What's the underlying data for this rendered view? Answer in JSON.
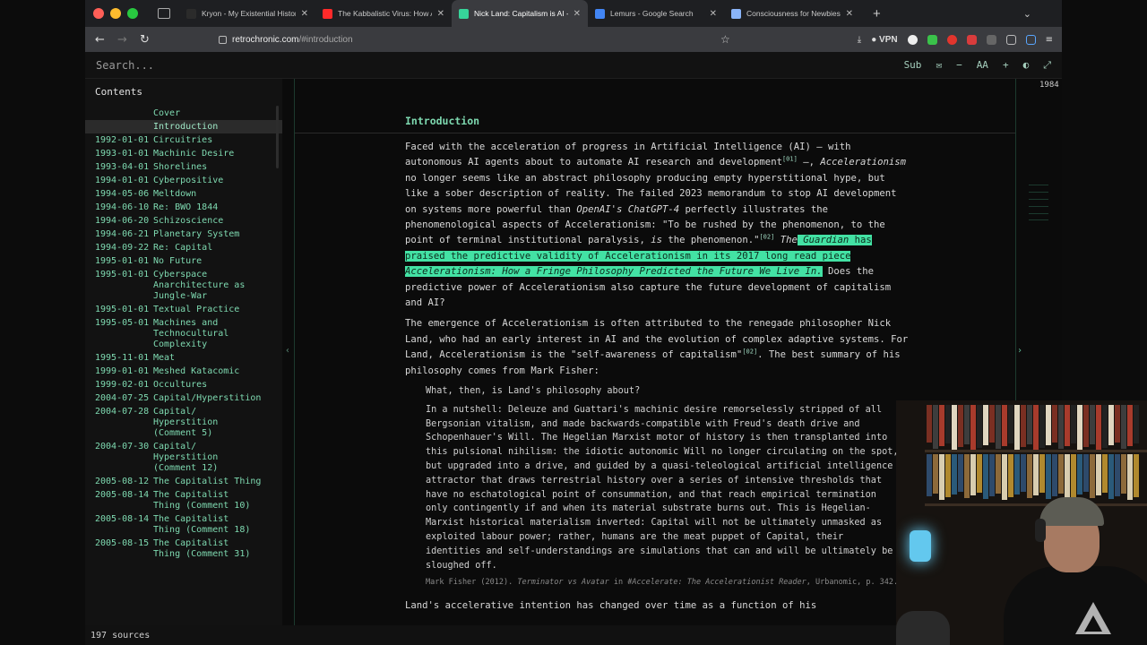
{
  "browser": {
    "tabs": [
      {
        "title": "Kryon - My Existential History -",
        "favicon_color": "#2b2b2b",
        "active": false
      },
      {
        "title": "The Kabbalistic Virus: How Artif",
        "favicon_color": "#ff2a2a",
        "active": false
      },
      {
        "title": "Nick Land: Capitalism is AI - Ac",
        "favicon_color": "#37d49a",
        "active": true
      },
      {
        "title": "Lemurs - Google Search",
        "favicon_color": "#4285f4",
        "active": false
      },
      {
        "title": "Consciousness for Newbies :: D",
        "favicon_color": "#8ab4f8",
        "active": false
      }
    ],
    "new_tab": "+",
    "url_host": "retrochronic.com",
    "url_path": "/#introduction",
    "vpn_label": "VPN"
  },
  "reader": {
    "search_placeholder": "Search...",
    "toolbar": {
      "sub_label": "Sub",
      "font_label": "AA",
      "minus": "−",
      "plus": "+"
    },
    "contents_label": "Contents",
    "page_number": "1984",
    "toc": [
      {
        "date": "",
        "title": "Cover",
        "indent": true,
        "selected": false
      },
      {
        "date": "",
        "title": "Introduction",
        "indent": true,
        "selected": true
      },
      {
        "date": "1992-01-01",
        "title": "Circuitries"
      },
      {
        "date": "1993-01-01",
        "title": "Machinic Desire"
      },
      {
        "date": "1993-04-01",
        "title": "Shorelines"
      },
      {
        "date": "1994-01-01",
        "title": "Cyberpositive"
      },
      {
        "date": "1994-05-06",
        "title": "Meltdown"
      },
      {
        "date": "1994-06-10",
        "title": "Re: BWO 1844"
      },
      {
        "date": "1994-06-20",
        "title": "Schizoscience"
      },
      {
        "date": "1994-06-21",
        "title": "Planetary System"
      },
      {
        "date": "1994-09-22",
        "title": "Re: Capital"
      },
      {
        "date": "1995-01-01",
        "title": "No Future"
      },
      {
        "date": "1995-01-01",
        "title": "Cyberspace\nAnarchitecture as\nJungle-War"
      },
      {
        "date": "1995-01-01",
        "title": "Textual Practice"
      },
      {
        "date": "1995-05-01",
        "title": "Machines and\nTechnocultural\nComplexity"
      },
      {
        "date": "1995-11-01",
        "title": "Meat"
      },
      {
        "date": "1999-01-01",
        "title": "Meshed Katacomic"
      },
      {
        "date": "1999-02-01",
        "title": "Occultures"
      },
      {
        "date": "2004-07-25",
        "title": "Capital/Hyperstition"
      },
      {
        "date": "2004-07-28",
        "title": "Capital/\nHyperstition\n(Comment 5)"
      },
      {
        "date": "2004-07-30",
        "title": "Capital/\nHyperstition\n(Comment 12)"
      },
      {
        "date": "2005-08-12",
        "title": "The Capitalist Thing"
      },
      {
        "date": "2005-08-14",
        "title": "The Capitalist\nThing (Comment 10)"
      },
      {
        "date": "2005-08-14",
        "title": "The Capitalist\nThing (Comment 18)"
      },
      {
        "date": "2005-08-15",
        "title": "The Capitalist\nThing (Comment 31)"
      }
    ],
    "sources_count": "197 sources"
  },
  "article": {
    "heading": "Introduction",
    "p1": {
      "a": "Faced with the acceleration of progress in Artificial Intelligence (AI) — with autonomous AI agents about to automate AI research and development",
      "ref1": "[01]",
      "b": " —, ",
      "accel": "Accelerationism",
      "c": " no longer seems like an abstract philosophy producing empty hyperstitional hype, but like a sober description of reality. The failed 2023 memorandum to stop AI development on systems more powerful than ",
      "openai": "OpenAI's ChatGPT-4",
      "d": " perfectly illustrates the phenomenological aspects of Accelerationism: \"To be rushed by the phenomenon, to the point of terminal institutional paralysis, ",
      "is": "is",
      "e": " the phenomenon.\"",
      "ref2": "[02]",
      "f": " ",
      "hl_the": "The",
      "hl_guardian": " Guardian",
      "hl_mid": " has praised the predictive validity of Accelerationism in its 2017 long read piece ",
      "hl_title": "Accelerationism: How a Fringe Philosophy Predicted the Future We Live In.",
      "g": " Does the predictive power of Accelerationism also capture the future development of capitalism and AI?"
    },
    "p2": {
      "a": "The emergence of Accelerationism is often attributed to the renegade philosopher Nick Land, who had an early interest in AI and the evolution of complex adaptive systems. For Land, Accelerationism is the \"self-awareness of capitalism\"",
      "ref": "[02]",
      "b": ". The best summary of his philosophy comes from Mark Fisher:"
    },
    "quote_q": "What, then, is Land's philosophy about?",
    "quote_body": "In a nutshell: Deleuze and Guattari's machinic desire remorselessly stripped of all Bergsonian vitalism, and made backwards-compatible with Freud's death drive and Schopenhauer's Will. The Hegelian Marxist motor of history is then transplanted into this pulsional nihilism: the idiotic autonomic Will no longer circulating on the spot, but upgraded into a drive, and guided by a quasi-teleological artificial intelligence attractor that draws terrestrial history over a series of intensive thresholds that have no eschatological point of consummation, and that reach empirical termination only contingently if and when its material substrate burns out. This is Hegelian-Marxist historical materialism inverted: Capital will not be ultimately unmasked as exploited labour power; rather, humans are the meat puppet of Capital, their identities and self-understandings are simulations that can and will be ultimately be sloughed off.",
    "cite_a": "Mark Fisher (2012). ",
    "cite_title": "Terminator vs Avatar",
    "cite_b": " in ",
    "cite_book": "#Accelerate: The Accelerationist Reader",
    "cite_c": ", Urbanomic, p. 342.",
    "p3": "Land's accelerative intention has changed over time as a function of his"
  }
}
